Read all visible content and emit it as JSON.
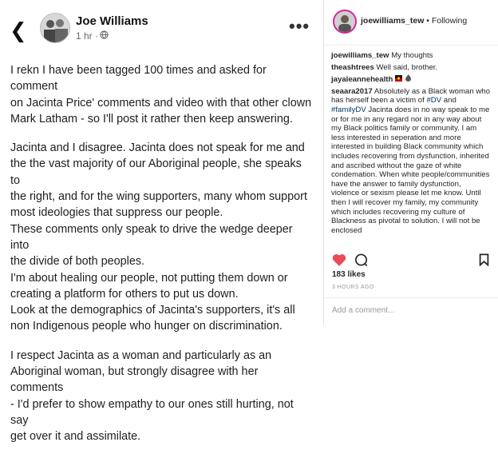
{
  "fb": {
    "author": "Joe Williams",
    "time": "1 hr ·",
    "paragraphs": [
      "I rekn I have been tagged 100 times and asked for comment\non Jacinta Price' comments and video with that other clown\nMark Latham - so I'll post it rather then keep answering.",
      "Jacinta and I disagree. Jacinta does not speak for me and\nthe the vast majority of our Aboriginal people, she speaks to\nthe right, and for the wing supporters, many whom support\nmost ideologies that suppress our people.\nThese comments only speak to drive the wedge deeper into\nthe divide of both peoples.\nI'm about healing our people, not putting them down or\ncreating a platform for others to put us down.\nLook at the demographics of Jacinta's supporters, it's all\nnon Indigenous people who hunger on discrimination.",
      "I respect Jacinta as a woman and particularly as an\nAboriginal woman, but strongly disagree with her comments\n- I'd prefer to show empathy to our ones still hurting, not say\nget over it and assimilate."
    ]
  },
  "ig": {
    "username": "joewilliams_tew",
    "following": " • Following",
    "comments": [
      {
        "user": "joewilliams_tew",
        "text": "My thoughts"
      },
      {
        "user": "theashtrees",
        "text": "Well said, brother."
      },
      {
        "user": "jayaleannehealth",
        "text": ""
      },
      {
        "user": "seaara2017",
        "text": "Absolutely as a Black woman who has herself been a victim of #DV and #familyDV Jacinta does in no way speak to me or for me in any regard nor in any way about my Black politics family or community. I am less interested in seperation and more interested in building Black community which includes recovering from dysfunction, inherited and ascribed without the gaze of white condemation. When white people/communities have the answer to family dysfunction, violence or sexism please let me know. Until then I will recover my family, my community which includes recovering my culture of Blackness as pivotal to solution. I will not be enclosed"
      }
    ],
    "likes": "183 likes",
    "ago": "3 HOURS AGO",
    "add_comment": "Add a comment...",
    "colors": {
      "heart": "#ed4956",
      "link": "#003569"
    }
  }
}
